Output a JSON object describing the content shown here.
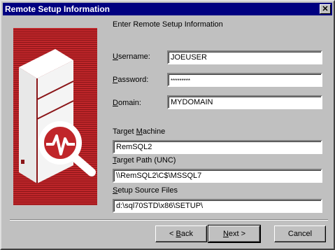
{
  "window": {
    "title": "Remote Setup Information"
  },
  "heading": "Enter Remote Setup Information",
  "form": {
    "username": {
      "label_pre": "",
      "label_ul": "U",
      "label_post": "sername:",
      "value": "JOEUSER"
    },
    "password": {
      "label_pre": "",
      "label_ul": "P",
      "label_post": "assword:",
      "value": "*********"
    },
    "domain": {
      "label_pre": "",
      "label_ul": "D",
      "label_post": "omain:",
      "value": "MYDOMAIN"
    },
    "target_machine": {
      "label_pre": "Target ",
      "label_ul": "M",
      "label_post": "achine",
      "value": "RemSQL2"
    },
    "target_path": {
      "label_pre": "",
      "label_ul": "T",
      "label_post": "arget Path (UNC)",
      "value": "\\\\RemSQL2\\C$\\MSSQL7"
    },
    "setup_source": {
      "label_pre": "",
      "label_ul": "S",
      "label_post": "etup Source Files",
      "value": "d:\\sql70STD\\x86\\SETUP\\"
    }
  },
  "buttons": {
    "back": {
      "pre": "< ",
      "ul": "B",
      "post": "ack"
    },
    "next": {
      "pre": "",
      "ul": "N",
      "post": "ext >"
    },
    "cancel": {
      "label": "Cancel"
    }
  },
  "colors": {
    "titlebar": "#000080",
    "art_red": "#c0262a"
  },
  "icons": {
    "close": "close-icon",
    "art": "server-magnifier-icon"
  }
}
